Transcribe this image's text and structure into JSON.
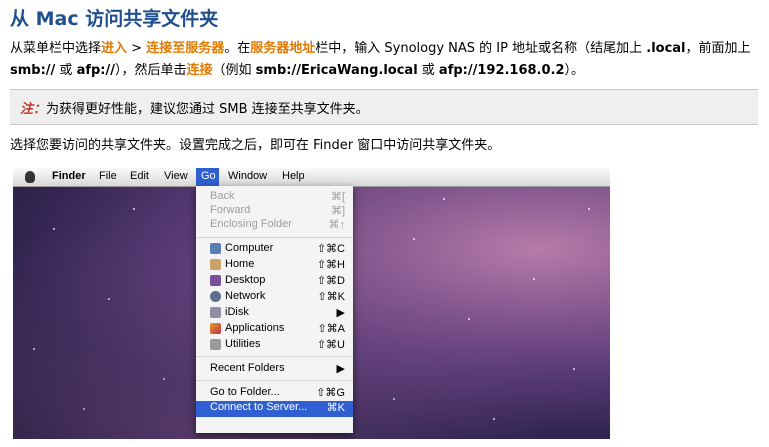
{
  "title": "从 Mac 访问共享文件夹",
  "intro": {
    "t1": "从菜单栏中选择",
    "enter": "进入",
    "gt": " > ",
    "connect": "连接至服务器",
    "t2": "。在",
    "server_address": "服务器地址",
    "t3": "栏中，输入 Synology NAS 的 IP 地址或名称（结尾加上 ",
    "local": ".local",
    "t4": "，前面加上 ",
    "smb": "smb://",
    "t5": " 或 ",
    "afp": "afp://",
    "t6": "），然后单击",
    "connect_btn": "连接",
    "t7": "（例如 ",
    "example1": "smb://EricaWang.local",
    "t8": " 或 ",
    "example2": "afp://192.168.0.2",
    "t9": "）。"
  },
  "note": {
    "label": "注：",
    "text": "为获得更好性能，建议您通过 SMB 连接至共享文件夹。"
  },
  "instruction": "选择您要访问的共享文件夹。设置完成之后，即可在 Finder 窗口中访问共享文件夹。",
  "screenshot": {
    "menubar": [
      "Finder",
      "File",
      "Edit",
      "View",
      "Go",
      "Window",
      "Help"
    ],
    "menu": {
      "back": {
        "label": "Back",
        "shortcut": "⌘["
      },
      "forward": {
        "label": "Forward",
        "shortcut": "⌘]"
      },
      "enclosing": {
        "label": "Enclosing Folder",
        "shortcut": "⌘↑"
      },
      "computer": {
        "label": "Computer",
        "shortcut": "⇧⌘C"
      },
      "home": {
        "label": "Home",
        "shortcut": "⇧⌘H"
      },
      "desktop": {
        "label": "Desktop",
        "shortcut": "⇧⌘D"
      },
      "network": {
        "label": "Network",
        "shortcut": "⇧⌘K"
      },
      "idisk": {
        "label": "iDisk",
        "shortcut": "▶"
      },
      "applications": {
        "label": "Applications",
        "shortcut": "⇧⌘A"
      },
      "utilities": {
        "label": "Utilities",
        "shortcut": "⇧⌘U"
      },
      "recent": {
        "label": "Recent Folders",
        "shortcut": "▶"
      },
      "goto": {
        "label": "Go to Folder...",
        "shortcut": "⇧⌘G"
      },
      "connect": {
        "label": "Connect to Server...",
        "shortcut": "⌘K"
      }
    }
  },
  "colors": {
    "title": "#1f4f8f",
    "highlight": "#e07a00",
    "note_label": "#c0392b",
    "menu_selection": "#2f5fd0"
  }
}
